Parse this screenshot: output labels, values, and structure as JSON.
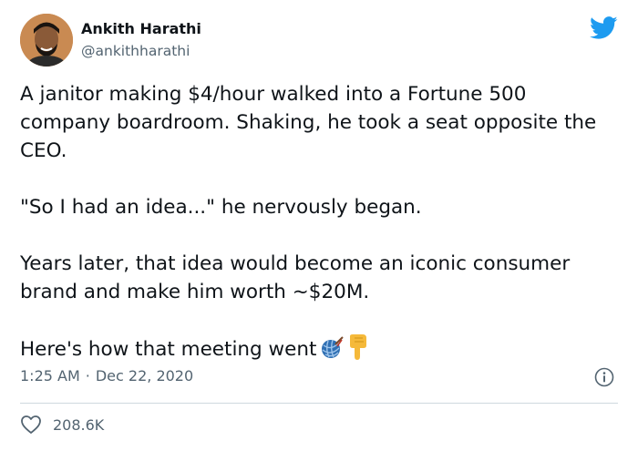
{
  "author": {
    "name": "Ankith Harathi",
    "handle": "@ankithharathi"
  },
  "tweet": {
    "paragraphs": [
      "A janitor making $4/hour walked into a Fortune 500 company boardroom. Shaking, he took a seat opposite the CEO.",
      "\"So I had an idea...\" he nervously began.",
      "Years later, that idea would become an iconic consumer brand and make him worth ~$20M."
    ],
    "closing_line": "Here's how that meeting went",
    "emojis": [
      "yarn-ball-icon",
      "backhand-index-pointing-down-icon"
    ]
  },
  "meta": {
    "time": "1:25 AM",
    "separator": "·",
    "date": "Dec 22, 2020"
  },
  "engagement": {
    "likes": "208.6K"
  },
  "colors": {
    "twitter_blue": "#1d9bf0",
    "text_primary": "#0f1419",
    "text_secondary": "#536471",
    "divider": "#cfd9de"
  }
}
